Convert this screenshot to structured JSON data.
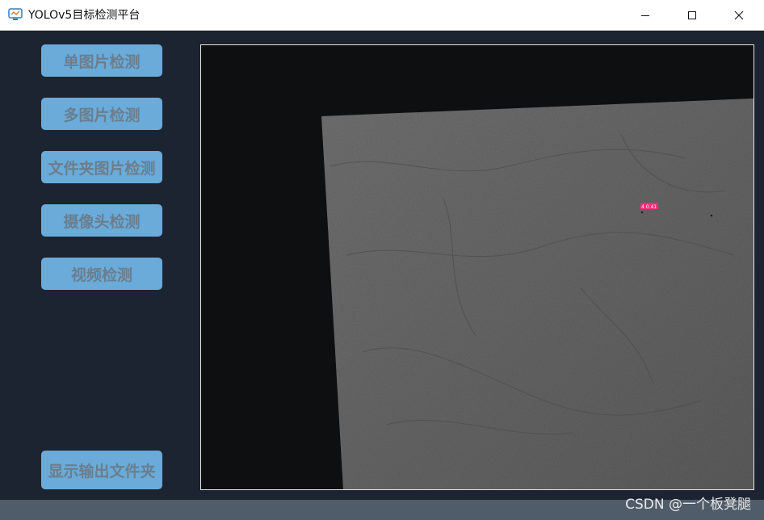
{
  "window": {
    "title": "YOLOv5目标检测平台"
  },
  "sidebar": {
    "buttons": [
      {
        "label": "单图片检测"
      },
      {
        "label": "多图片检测"
      },
      {
        "label": "文件夹图片检测"
      },
      {
        "label": "摄像头检测"
      },
      {
        "label": "视频检测"
      }
    ],
    "output_button": {
      "label": "显示输出文件夹"
    }
  },
  "viewer": {
    "detection_label": "4 0.41"
  },
  "watermark": "CSDN @一个板凳腿",
  "colors": {
    "sidebar_bg": "#1b2430",
    "button_bg": "#6aabd9",
    "button_text": "#6a7e8e",
    "viewer_bg": "#0e0f10",
    "statusbar_bg": "#505c69",
    "detection_box": "#ff2d78"
  }
}
